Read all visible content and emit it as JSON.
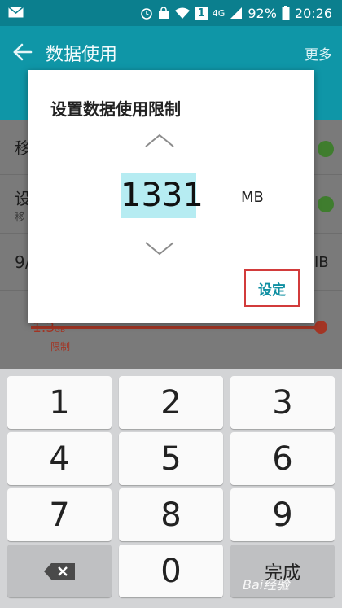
{
  "status_bar": {
    "sim_badge": "1",
    "network": "4G",
    "battery": "92%",
    "time": "20:26",
    "icons": [
      "mail-icon",
      "alarm-icon",
      "sim-lock-icon",
      "wifi-icon",
      "signal-icon",
      "battery-icon"
    ]
  },
  "action_bar": {
    "title": "数据使用",
    "more": "更多"
  },
  "background": {
    "row1": "移",
    "row2": "设",
    "row2_sub": "移",
    "row3": "9/",
    "row3_suffix": "IB",
    "limit_value": "1.3",
    "limit_unit": "GB",
    "limit_label": "限制",
    "toggle_color": "#3f7d2e",
    "limit_color": "#a33524"
  },
  "dialog": {
    "title": "设置数据使用限制",
    "value": "1331",
    "unit": "MB",
    "confirm": "设定",
    "highlight_color": "#b6ecf2"
  },
  "keypad": {
    "keys": [
      "1",
      "2",
      "3",
      "4",
      "5",
      "6",
      "7",
      "8",
      "9",
      "0"
    ],
    "done": "完成",
    "watermark": "Bai经验"
  },
  "colors": {
    "status_bar": "#0b7f8e",
    "action_bar": "#0f96a7",
    "accent": "#0f8fa2",
    "annotation_box": "#d23b3b"
  }
}
